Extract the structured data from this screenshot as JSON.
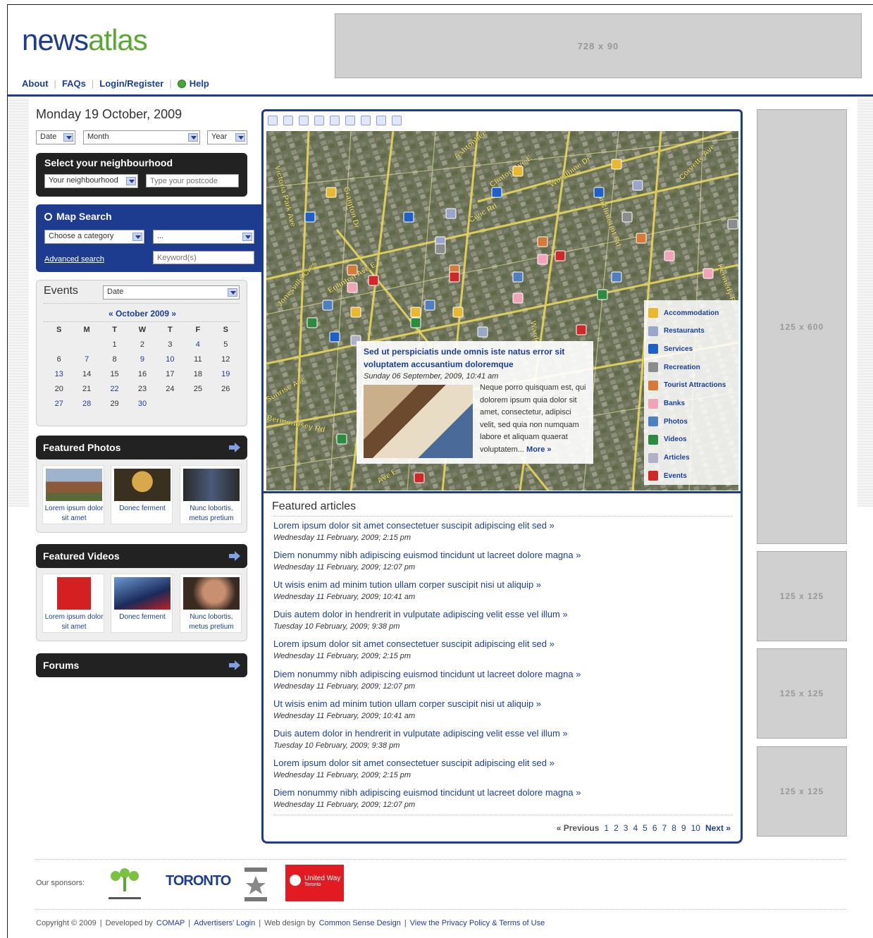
{
  "header": {
    "logo_news": "news",
    "logo_atlas": "atlas",
    "leaderboard_label": "728 x 90",
    "nav": {
      "about": "About",
      "faqs": "FAQs",
      "login": "Login/Register",
      "help": "Help"
    }
  },
  "date_title": "Monday 19 October, 2009",
  "date_selects": {
    "day": "Date",
    "month": "Month",
    "year": "Year"
  },
  "neighbourhood": {
    "title": "Select your neighbourhood",
    "select_value": "Your neighbourhood",
    "postcode_placeholder": "Type your postcode"
  },
  "map_search": {
    "title": "Map Search",
    "category_value": "Choose a category",
    "sub_value": "...",
    "keyword_placeholder": "Keyword(s)",
    "advanced_label": "Advanced search"
  },
  "events": {
    "title": "Events",
    "select_value": "Date",
    "month_label": "« October 2009 »",
    "weekday_headers": [
      "S",
      "M",
      "T",
      "W",
      "T",
      "F",
      "S"
    ],
    "days": [
      [
        "",
        "",
        "1",
        "2",
        "3",
        "4",
        "5"
      ],
      [
        "6",
        "7",
        "8",
        "9",
        "10",
        "11",
        "12"
      ],
      [
        "13",
        "14",
        "15",
        "16",
        "17",
        "18",
        "19"
      ],
      [
        "20",
        "21",
        "22",
        "23",
        "24",
        "25",
        "26"
      ],
      [
        "27",
        "28",
        "29",
        "30",
        "",
        "",
        ""
      ]
    ],
    "linked_days": [
      "4",
      "7",
      "9",
      "10",
      "13",
      "19",
      "22",
      "27",
      "28",
      "30"
    ]
  },
  "featured_photos": {
    "title": "Featured Photos",
    "items": [
      {
        "caption": "Lorem ipsum dolor sit amet"
      },
      {
        "caption": "Donec ferment"
      },
      {
        "caption": "Nunc lobortis, metus pretium"
      }
    ]
  },
  "featured_videos": {
    "title": "Featured Videos",
    "items": [
      {
        "caption": "Lorem ipsum dolor sit amet"
      },
      {
        "caption": "Donec ferment"
      },
      {
        "caption": "Nunc lobortis, metus pretium"
      }
    ]
  },
  "forums_title": "Forums",
  "map": {
    "legend": [
      {
        "label": "Accommodation",
        "icon": "key-icon",
        "color": "#e8b830"
      },
      {
        "label": "Restaurants",
        "icon": "cocktail-icon",
        "color": "#9aa6c8"
      },
      {
        "label": "Services",
        "icon": "dollar-icon",
        "color": "#1e60c8"
      },
      {
        "label": "Recreation",
        "icon": "music-icon",
        "color": "#8c8c8c"
      },
      {
        "label": "Tourist Attractions",
        "icon": "landmark-icon",
        "color": "#d47a3a"
      },
      {
        "label": "Banks",
        "icon": "piggy-bank-icon",
        "color": "#f0a4b8"
      },
      {
        "label": "Photos",
        "icon": "camera-icon",
        "color": "#4f7fc0"
      },
      {
        "label": "Videos",
        "icon": "film-icon",
        "color": "#2d8a3e"
      },
      {
        "label": "Articles",
        "icon": "tag-icon",
        "color": "#b0b0c8"
      },
      {
        "label": "Events",
        "icon": "calendar-icon",
        "color": "#d02828"
      }
    ],
    "popup": {
      "title": "Sed ut perspiciatis unde omnis iste natus error sit voluptatem accusantium doloremque",
      "date": "Sunday 06 September, 2009, 10:41 am",
      "body": "Neque porro quisquam est, qui dolorem ipsum quia dolor sit amet, consectetur, adipisci velit, sed quia non numquam labore et aliquam quaerat voluptatem...",
      "more": "More »"
    },
    "street_labels": [
      "Ashtonbee",
      "Clinton Ave E",
      "Woodbine Dr",
      "Corvette Ave",
      "Victoria Park Ave",
      "Craigton Dr",
      "Civic Rd",
      "Eglinton Ave E",
      "Jonesville Cres",
      "Warden",
      "Sunrise Ave",
      "Bermondsey Rd",
      "Ave E",
      "Kennedy Rd",
      "Birchmount Rd"
    ]
  },
  "articles": {
    "title": "Featured articles",
    "items": [
      {
        "title": "Lorem ipsum dolor sit amet consectetuer suscipit adipiscing elit sed »",
        "date": "Wednesday 11 February, 2009; 2:15 pm"
      },
      {
        "title": "Diem nonummy nibh adipiscing euismod tincidunt ut lacreet dolore magna »",
        "date": "Wednesday 11 February, 2009; 12:07 pm"
      },
      {
        "title": "Ut wisis enim ad minim tution ullam corper suscipit nisi ut aliquip »",
        "date": "Wednesday 11 February, 2009; 10:41 am"
      },
      {
        "title": "Duis autem dolor in hendrerit in vulputate adipiscing velit esse vel illum »",
        "date": "Tuesday 10 February, 2009; 9:38 pm"
      },
      {
        "title": "Lorem ipsum dolor sit amet consectetuer suscipit adipiscing elit sed »",
        "date": "Wednesday 11 February, 2009; 2:15 pm"
      },
      {
        "title": "Diem nonummy nibh adipiscing euismod tincidunt ut lacreet dolore magna »",
        "date": "Wednesday 11 February, 2009; 12:07 pm"
      },
      {
        "title": "Ut wisis enim ad minim tution ullam corper suscipit nisi ut aliquip »",
        "date": "Wednesday 11 February, 2009; 10:41 am"
      },
      {
        "title": "Duis autem dolor in hendrerit in vulputate adipiscing velit esse vel illum »",
        "date": "Tuesday 10 February, 2009; 9:38 pm"
      },
      {
        "title": "Lorem ipsum dolor sit amet consectetuer suscipit adipiscing elit sed »",
        "date": "Wednesday 11 February, 2009; 2:15 pm"
      },
      {
        "title": "Diem nonummy nibh adipiscing euismod tincidunt ut lacreet dolore magna »",
        "date": "Wednesday 11 February, 2009; 12:07 pm"
      }
    ],
    "pager": {
      "previous": "« Previous",
      "pages": [
        "1",
        "2",
        "3",
        "4",
        "5",
        "6",
        "7",
        "8",
        "9",
        "10"
      ],
      "next": "Next »"
    }
  },
  "ads": {
    "skyscraper": "125 x 600",
    "square1": "125 x 125",
    "square2": "125 x 125",
    "square3": "125 x 125"
  },
  "footer": {
    "sponsors_label": "Our sponsors:",
    "sponsor_toronto": "TORONTO",
    "sponsor_united_way": "United Way",
    "sponsor_united_way_sub": "Toronto",
    "copyright": "Copyright © 2009",
    "developed_by": "Developed by",
    "comap": "COMAP",
    "advertisers_login": "Advertisers' Login",
    "web_design_by": "Web design by",
    "csd": "Common Sense Design",
    "privacy": "View the Privacy Policy & Terms of Use"
  }
}
